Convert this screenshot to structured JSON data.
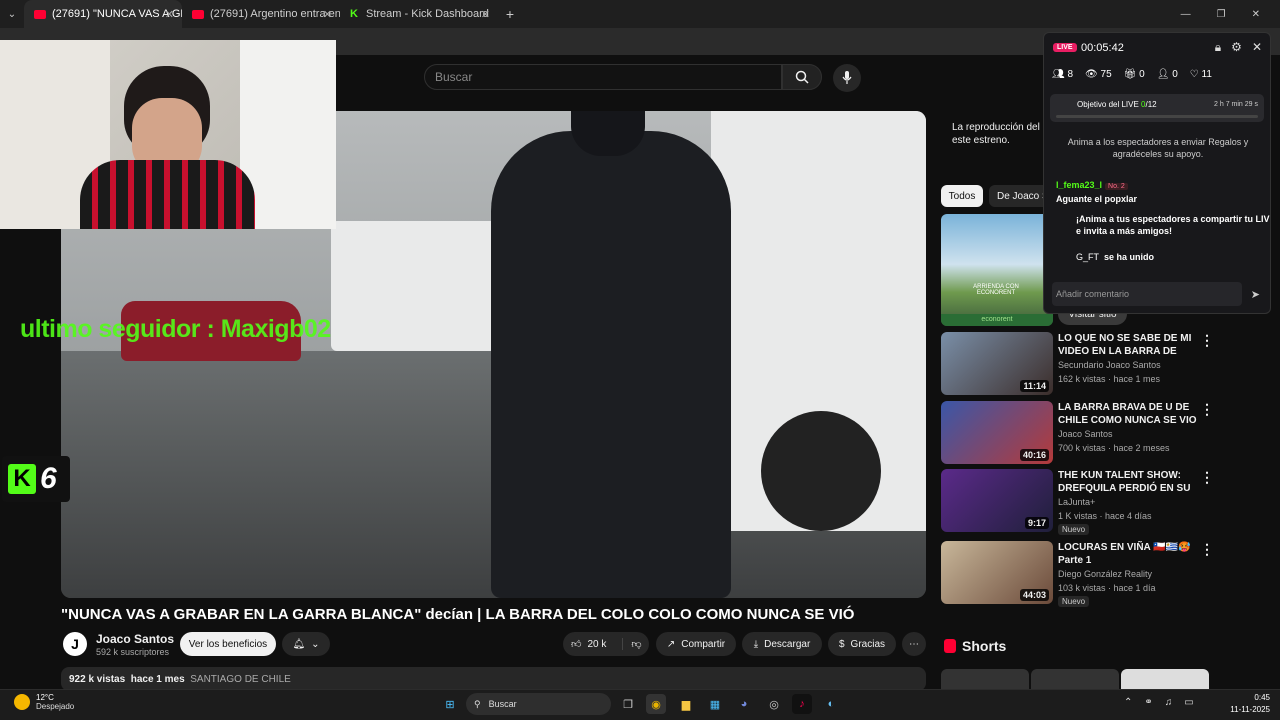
{
  "tabs": [
    {
      "label": "(27691) \"NUNCA VAS A GR",
      "favicon": "youtube-icon",
      "active": true
    },
    {
      "label": "(27691) Argentino entra en la B",
      "favicon": "youtube-icon",
      "active": false
    },
    {
      "label": "Stream - Kick Dashboard",
      "favicon": "kick-icon",
      "active": false
    }
  ],
  "header": {
    "search_placeholder": "Buscar"
  },
  "overlay": {
    "last_follower": "ultimo seguidor : Maxigb02",
    "kick_count": "6"
  },
  "video": {
    "title": "\"NUNCA VAS A GRABAR EN LA GARRA BLANCA\" decían | LA BARRA DEL COLO COLO COMO NUNCA SE VIÓ",
    "channel": "Joaco Santos",
    "channel_initial": "J",
    "subscribers": "592 k suscriptores",
    "benefits_label": "Ver los beneficios",
    "likes": "20 k",
    "share_label": "Compartir",
    "download_label": "Descargar",
    "thanks_label": "Gracias",
    "views": "922 k vistas",
    "age": "hace 1 mes",
    "location": "SANTIAGO DE CHILE"
  },
  "sidebar": {
    "chat_disabled": "La reproducción del chat está inhabilitada para este estreno.",
    "chips": [
      "Todos",
      "De Joaco Santos"
    ],
    "ad": {
      "text": "ARRIENDA CON ECONORENT",
      "brand": "econorent",
      "visit_label": "Visitar sitio"
    },
    "recommendations": [
      {
        "title": "LO QUE NO SE SABE DE MI VIDEO EN LA BARRA DE COLO...",
        "channel": "Secundario Joaco Santos",
        "meta": "162 k vistas · hace 1 mes",
        "duration": "11:14",
        "nuevo": ""
      },
      {
        "title": "LA BARRA BRAVA DE U DE CHILE COMO NUNCA SE VIO | ...",
        "channel": "Joaco Santos",
        "meta": "700 k vistas · hace 2 meses",
        "duration": "40:16",
        "nuevo": ""
      },
      {
        "title": "THE KUN TALENT SHOW: DREFQUILA PERDIÓ EN SU ...",
        "channel": "LaJunta+",
        "meta": "1 K vistas · hace 4 días",
        "duration": "9:17",
        "nuevo": "Nuevo"
      },
      {
        "title": "LOCURAS EN VIÑA 🇨🇱🇺🇾🥵 Parte 1",
        "channel": "Diego González Reality",
        "meta": "103 k vistas · hace 1 día",
        "duration": "44:03",
        "nuevo": "Nuevo"
      }
    ],
    "shorts_label": "Shorts"
  },
  "kick": {
    "live": "LIVE",
    "timer": "00:05:42",
    "stats": [
      {
        "icon": "followers-icon",
        "value": "8"
      },
      {
        "icon": "eye-icon",
        "value": "75"
      },
      {
        "icon": "gift-icon",
        "value": "0"
      },
      {
        "icon": "subs-icon",
        "value": "0"
      },
      {
        "icon": "heart-icon",
        "value": "11"
      }
    ],
    "goal_label": "Objetivo del LIVE",
    "goal_current": "0",
    "goal_total": "/12",
    "goal_progress": 0,
    "goal_time": "2 h 7 min 29 s",
    "prompt": "Anima a los espectadores a enviar Regalos y agradéceles su apoyo.",
    "chat": [
      {
        "user": "l_fema23_l",
        "badge": "No. 2",
        "text": "Aguante el popxlar"
      }
    ],
    "share_prompt": "¡Anima a tus espectadores a compartir tu LIVE e invita a más amigos!",
    "joined_user": "G_FT",
    "joined_text": "se ha unido",
    "input_placeholder": "Añadir comentario"
  },
  "taskbar": {
    "temp": "12°C",
    "weather": "Despejado",
    "search": "Buscar",
    "time": "0:45",
    "date": "11-11-2025"
  }
}
